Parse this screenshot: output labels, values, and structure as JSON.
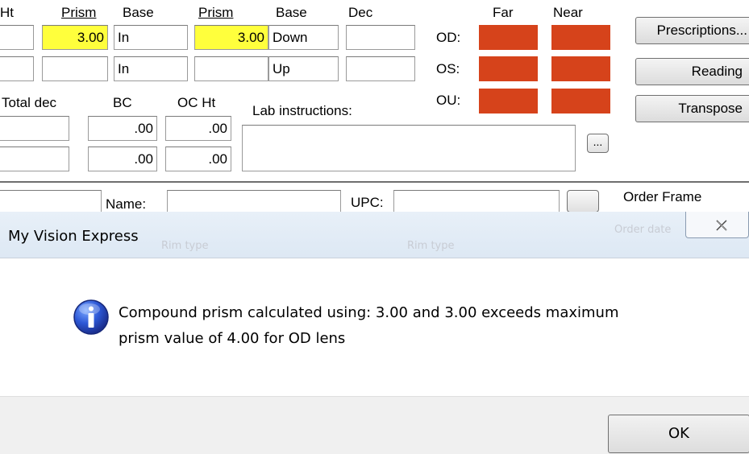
{
  "rx_table": {
    "headers": {
      "ht": "Ht",
      "prism1": "Prism",
      "base1": "Base",
      "prism2": "Prism",
      "base2": "Base",
      "dec": "Dec",
      "far": "Far",
      "near": "Near"
    },
    "od": {
      "label": "OD:",
      "prism1": "3.00",
      "base1": "In",
      "prism2": "3.00",
      "base2": "Down",
      "dec": ""
    },
    "os": {
      "label": "OS:",
      "prism1": "",
      "base1": "In",
      "prism2": "",
      "base2": "Up",
      "dec": ""
    },
    "ou": {
      "label": "OU:"
    },
    "highlight_color": "#ffff3c",
    "swatch_color": "#d6431b"
  },
  "buttons": {
    "prescriptions": "Prescriptions...",
    "reading": "Reading",
    "transpose": "Transpose",
    "ellipsis": "..."
  },
  "lower": {
    "total_dec_label": "Total dec",
    "bc_label": "BC",
    "ocht_label": "OC Ht",
    "lab_instructions_label": "Lab instructions:",
    "bc_od": ".00",
    "bc_os": ".00",
    "ocht_od": ".00",
    "ocht_os": ".00"
  },
  "frame_row": {
    "name_label": "Name:",
    "upc_label": "UPC:",
    "order_frame_label": "Order Frame"
  },
  "dialog": {
    "title": "My Vision Express",
    "message_line1": "Compound prism calculated using: 3.00 and 3.00 exceeds maximum",
    "message_line2": "prism value of 4.00 for OD lens",
    "ok_label": "OK",
    "info_icon": "info-icon",
    "close_icon": "close-icon"
  }
}
